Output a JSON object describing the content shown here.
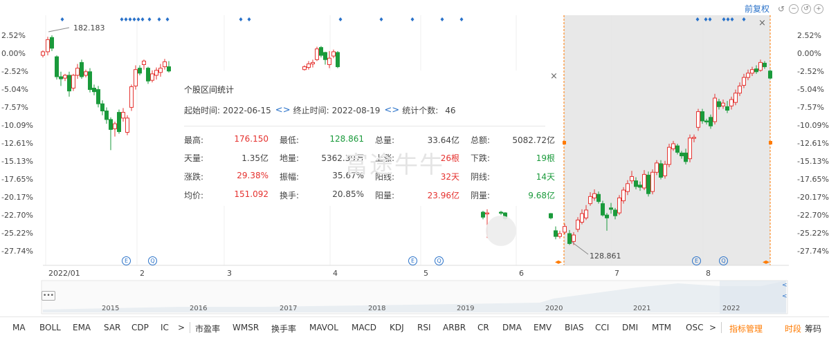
{
  "toolbar": {
    "fq_label": "前复权",
    "undo_icon": "undo-icon",
    "close_icon": "close-icon",
    "restore_icon": "restore-icon",
    "zoom_icon": "zoom-icon"
  },
  "chart": {
    "y_labels": [
      "2.52%",
      "0.00%",
      "-2.52%",
      "-5.04%",
      "-7.57%",
      "-10.09%",
      "-12.61%",
      "-15.13%",
      "-17.65%",
      "-20.17%",
      "-22.70%",
      "-25.22%",
      "-27.74%"
    ],
    "x_labels": [
      "2022/01",
      "2",
      "3",
      "4",
      "5",
      "6",
      "7",
      "8"
    ],
    "high_label": "182.183",
    "low_label": "128.861",
    "timeline_labels": [
      "2015",
      "2016",
      "2017",
      "2018",
      "2019",
      "2020",
      "2021",
      "2022"
    ],
    "event_e": "E",
    "event_q": "Q",
    "selection_close": "×",
    "colors": {
      "up": "#e5312e",
      "down": "#1a9a3b",
      "accent": "#2a72c9",
      "range": "#ff7a00"
    }
  },
  "popup": {
    "title": "个股区间统计",
    "close": "×",
    "start_label": "起始时间:",
    "start_value": "2022-06-15",
    "end_label": "终止时间:",
    "end_value": "2022-08-19",
    "count_label": "统计个数:",
    "count_value": "46",
    "chevrons": "<>",
    "stats": [
      {
        "label": "最高:",
        "value": "176.150",
        "color": "red"
      },
      {
        "label": "最低:",
        "value": "128.861",
        "color": "green"
      },
      {
        "label": "总量:",
        "value": "33.64亿",
        "color": ""
      },
      {
        "label": "总额:",
        "value": "5082.72亿",
        "color": ""
      },
      {
        "label": "天量:",
        "value": "1.35亿",
        "color": ""
      },
      {
        "label": "地量:",
        "value": "5362.39万",
        "color": ""
      },
      {
        "label": "上涨:",
        "value": "26根",
        "color": "red"
      },
      {
        "label": "下跌:",
        "value": "19根",
        "color": "green"
      },
      {
        "label": "涨跌:",
        "value": "29.38%",
        "color": "red"
      },
      {
        "label": "振幅:",
        "value": "35.67%",
        "color": ""
      },
      {
        "label": "阳线:",
        "value": "32天",
        "color": "red"
      },
      {
        "label": "阴线:",
        "value": "14天",
        "color": "green"
      },
      {
        "label": "均价:",
        "value": "151.092",
        "color": "red"
      },
      {
        "label": "换手:",
        "value": "20.85%",
        "color": ""
      },
      {
        "label": "阳量:",
        "value": "23.96亿",
        "color": "red"
      },
      {
        "label": "阴量:",
        "value": "9.68亿",
        "color": "green"
      }
    ],
    "watermark": "富途牛牛"
  },
  "indicators": {
    "left": [
      "MA",
      "BOLL",
      "EMA",
      "SAR",
      "CDP",
      "IC"
    ],
    "left_more": ">",
    "right": [
      "市盈率",
      "WMSR",
      "换手率",
      "MAVOL",
      "MACD",
      "KDJ",
      "RSI",
      "ARBR",
      "CR",
      "DMA",
      "EMV",
      "BIAS",
      "CCI",
      "DMI",
      "MTM",
      "OSC"
    ],
    "right_more": ">",
    "manage": "指标管理",
    "tab_time": "时段",
    "tab_chip": "筹码"
  },
  "timeline": {
    "more": "•••",
    "arrow_left": "<",
    "arrow_right": "<"
  }
}
